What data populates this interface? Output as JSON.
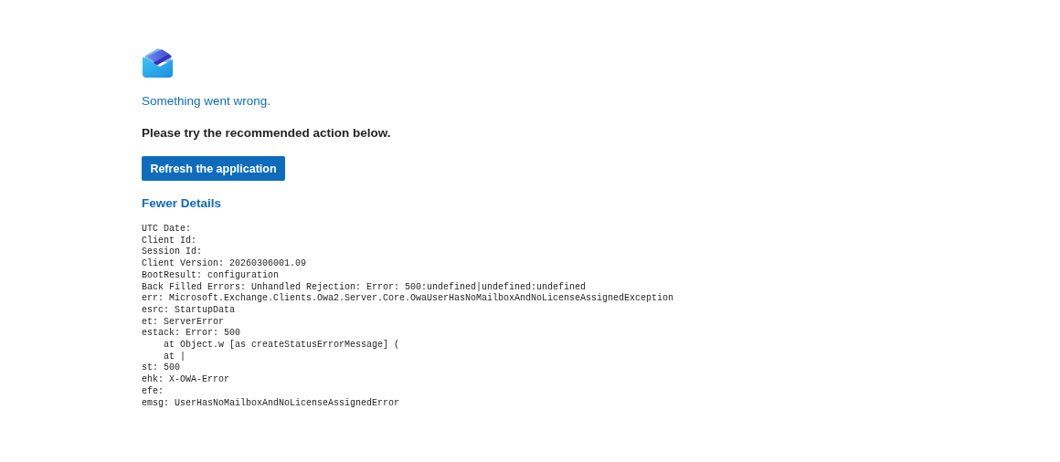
{
  "error": {
    "title": "Something went wrong.",
    "instruction": "Please try the recommended action below.",
    "action_button": "Refresh the application",
    "details_toggle": "Fewer Details",
    "details": [
      "UTC Date:",
      "Client Id:",
      "Session Id:",
      "Client Version: 20260306001.09",
      "BootResult: configuration",
      "Back Filled Errors: Unhandled Rejection: Error: 500:undefined|undefined:undefined",
      "err: Microsoft.Exchange.Clients.Owa2.Server.Core.OwaUserHasNoMailboxAndNoLicenseAssignedException",
      "esrc: StartupData",
      "et: ServerError",
      "estack: Error: 500",
      "    at Object.w [as createStatusErrorMessage] (",
      "    at |",
      "st: 500",
      "ehk: X-OWA-Error",
      "efe:",
      "emsg: UserHasNoMailboxAndNoLicenseAssignedError"
    ]
  }
}
